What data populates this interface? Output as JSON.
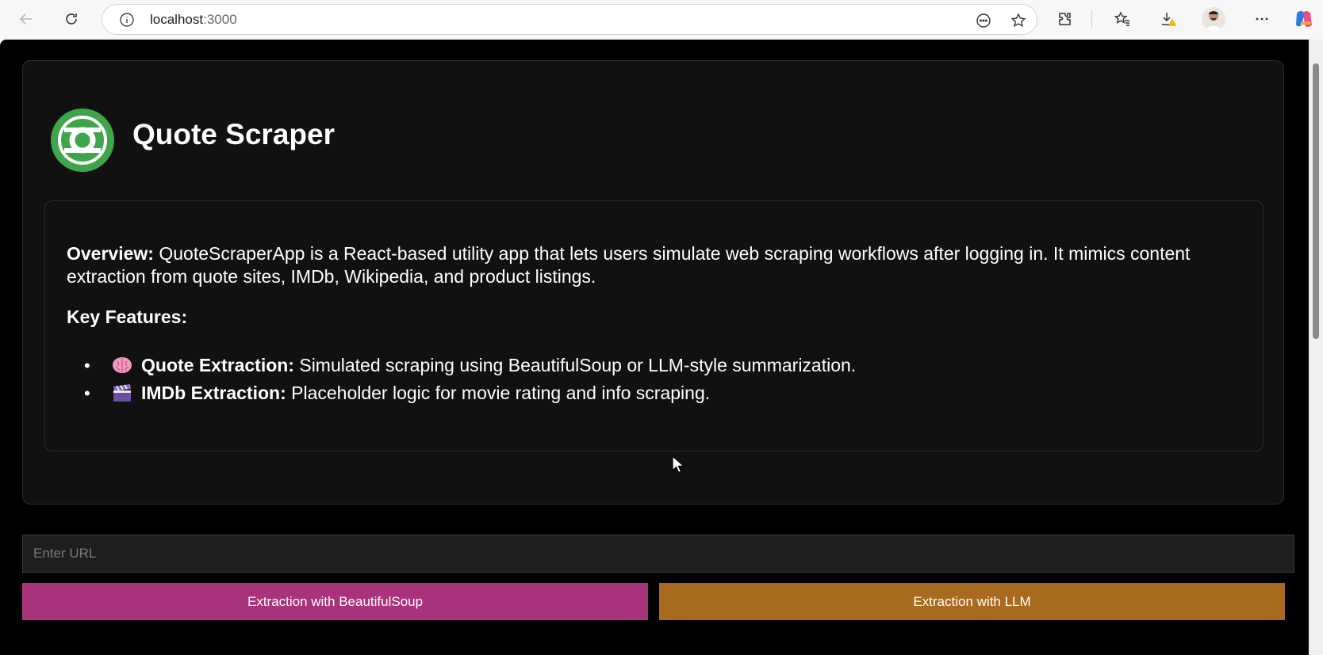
{
  "browser": {
    "url_host": "localhost",
    "url_port": ":3000"
  },
  "app": {
    "title": "Quote Scraper",
    "overview_label": "Overview:",
    "overview_text": " QuoteScraperApp is a React-based utility app that lets users simulate web scraping workflows after logging in. It mimics content extraction from quote sites, IMDb, Wikipedia, and product listings.",
    "key_features_heading": "Key Features:",
    "features": [
      {
        "icon": "brain-icon",
        "label": "Quote Extraction:",
        "text": " Simulated scraping using BeautifulSoup or LLM-style summarization."
      },
      {
        "icon": "clapper-board-icon",
        "label": "IMDb Extraction:",
        "text": " Placeholder logic for movie rating and info scraping."
      }
    ],
    "url_input": {
      "placeholder": "Enter URL",
      "value": ""
    },
    "buttons": {
      "beautifulsoup": "Extraction with BeautifulSoup",
      "llm": "Extraction with LLM"
    }
  },
  "colors": {
    "logo_green": "#3fa54a",
    "bs_button": "#a8337a",
    "llm_button": "#a86a1e",
    "page_bg": "#000000",
    "card_bg": "#111111"
  }
}
